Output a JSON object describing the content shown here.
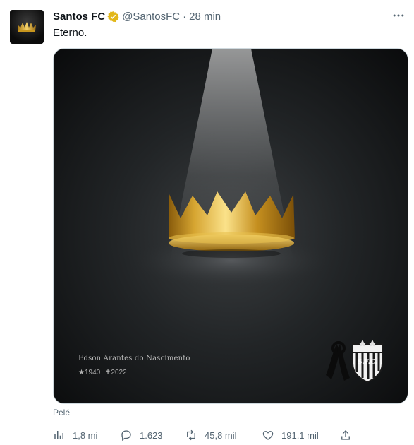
{
  "tweet": {
    "author_name": "Santos FC",
    "author_handle": "@SantosFC",
    "separator": "·",
    "time": "28 min",
    "text": "Eterno.",
    "verified_color": "#e2b719",
    "media": {
      "name_line": "Edson Arantes do Nascimento",
      "birth": "★1940",
      "death": "✝2022",
      "alt_label": "Pelé",
      "crest_text": "S.F.C."
    },
    "metrics": {
      "views": "1,8 mi",
      "replies": "1.623",
      "retweets": "45,8 mil",
      "likes": "191,1 mil"
    },
    "icons": [
      "views-icon",
      "reply-icon",
      "retweet-icon",
      "like-icon",
      "share-icon",
      "more-icon",
      "verified-icon"
    ]
  }
}
